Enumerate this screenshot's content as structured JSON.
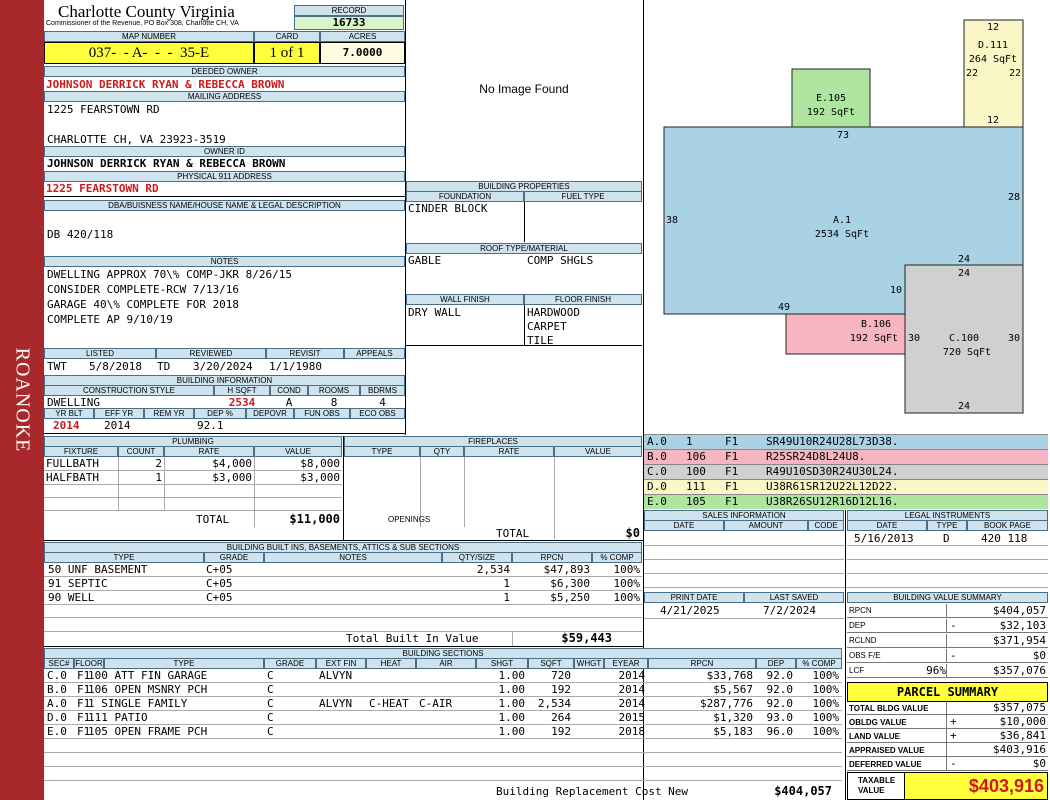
{
  "sidebar_label": "ROANOKE",
  "county": "Charlotte County Virginia",
  "commissioner": "Commissioner of the Revenue, PO Box 308, Charlotte CH, VA",
  "record": {
    "label": "RECORD",
    "value": "16733"
  },
  "map_number": {
    "label": "MAP NUMBER",
    "value": "037-  - A-  -  -  35-E"
  },
  "card": {
    "label": "CARD",
    "value": "1 of 1"
  },
  "acres": {
    "label": "ACRES",
    "value": "7.0000"
  },
  "deeded_owner": {
    "label": "DEEDED OWNER",
    "value": "JOHNSON DERRICK RYAN & REBECCA BROWN"
  },
  "mailing": {
    "label": "MAILING ADDRESS",
    "line1": "1225 FEARSTOWN RD",
    "line2": "CHARLOTTE CH, VA 23923-3519"
  },
  "owner_id": {
    "label": "OWNER ID",
    "value": "JOHNSON DERRICK RYAN & REBECCA BROWN"
  },
  "address911": {
    "label": "PHYSICAL 911 ADDRESS",
    "value": "1225 FEARSTOWN RD"
  },
  "dba": {
    "label": "DBA/BUISNESS NAME/HOUSE NAME & LEGAL DESCRIPTION",
    "value": "DB 420/118"
  },
  "notes": {
    "label": "NOTES",
    "lines": [
      "DWELLING APPROX 70\\% COMP-JKR 8/26/15",
      "CONSIDER COMPLETE-RCW 7/13/16",
      "GARAGE 40\\% COMPLETE FOR 2018",
      "COMPLETE AP 9/10/19"
    ]
  },
  "no_image": "No Image Found",
  "building_properties": {
    "label": "BUILDING PROPERTIES",
    "foundation_label": "FOUNDATION",
    "fuel_label": "FUEL TYPE",
    "foundation": "CINDER BLOCK",
    "roof_label": "ROOF TYPE/MATERIAL",
    "roof_type": "GABLE",
    "roof_material": "COMP SHGLS",
    "wall_label": "WALL FINISH",
    "floor_label": "FLOOR FINISH",
    "wall": "DRY WALL",
    "floor": [
      "HARDWOOD",
      "CARPET",
      "TILE"
    ]
  },
  "listed": {
    "label": "LISTED",
    "code": "TWT",
    "date": "5/8/2018"
  },
  "reviewed": {
    "label": "REVIEWED",
    "code": "TD",
    "date": "3/20/2024"
  },
  "revisit": {
    "label": "REVISIT",
    "date": "1/1/1980"
  },
  "appeals": {
    "label": "APPEALS"
  },
  "building_info": {
    "label": "BUILDING INFORMATION",
    "style_label": "CONSTRUCTION STYLE",
    "hsqft_label": "H SQFT",
    "cond_label": "COND",
    "rooms_label": "ROOMS",
    "bdrms_label": "BDRMS",
    "style": "DWELLING",
    "hsqft": "2534",
    "cond": "A",
    "rooms": "8",
    "bdrms": "4",
    "yrblt_label": "YR BLT",
    "effyr_label": "EFF YR",
    "remyr_label": "REM YR",
    "dep_label": "DEP %",
    "depovr_label": "DEPOVR",
    "funobs_label": "FUN OBS",
    "ecoobs_label": "ECO OBS",
    "yrblt": "2014",
    "effyr": "2014",
    "dep": "92.1"
  },
  "plumbing": {
    "label": "PLUMBING",
    "headers": [
      "FIXTURE",
      "COUNT",
      "RATE",
      "VALUE"
    ],
    "rows": [
      [
        "FULLBATH",
        "2",
        "$4,000",
        "$8,000"
      ],
      [
        "HALFBATH",
        "1",
        "$3,000",
        "$3,000"
      ]
    ],
    "total_label": "TOTAL",
    "total": "$11,000"
  },
  "fireplaces": {
    "label": "FIREPLACES",
    "headers": [
      "TYPE",
      "QTY",
      "RATE",
      "VALUE"
    ],
    "openings_label": "OPENINGS",
    "total_label": "TOTAL",
    "total": "$0"
  },
  "built_ins": {
    "label": "BUILDING BUILT INS, BASEMENTS, ATTICS & SUB SECTIONS",
    "headers": [
      "TYPE",
      "GRADE",
      "NOTES",
      "QTY/SIZE",
      "RPCN",
      "% COMP"
    ],
    "rows": [
      [
        "50 UNF BASEMENT",
        "C+05",
        "",
        "2,534",
        "$47,893",
        "100%"
      ],
      [
        "91 SEPTIC",
        "C+05",
        "",
        "1",
        "$6,300",
        "100%"
      ],
      [
        "90 WELL",
        "C+05",
        "",
        "1",
        "$5,250",
        "100%"
      ]
    ],
    "total_label": "Total Built In Value",
    "total": "$59,443"
  },
  "sketch": {
    "labels": [
      {
        "name": "A.1",
        "sqft": "2534 SqFt"
      },
      {
        "name": "B.106",
        "sqft": "192 SqFt"
      },
      {
        "name": "C.100",
        "sqft": "720 SqFt"
      },
      {
        "name": "D.111",
        "sqft": "264 SqFt"
      },
      {
        "name": "E.105",
        "sqft": "192 SqFt"
      }
    ],
    "dims": [
      "12",
      "22",
      "22",
      "12",
      "73",
      "28",
      "38",
      "24",
      "24",
      "10",
      "49",
      "30",
      "30",
      "24"
    ]
  },
  "vectors": [
    [
      "A.0",
      "1",
      "F1",
      "SR49U10R24U28L73D38."
    ],
    [
      "B.0",
      "106",
      "F1",
      "R25SR24D8L24U8."
    ],
    [
      "C.0",
      "100",
      "F1",
      "R49U10SD30R24U30L24."
    ],
    [
      "D.0",
      "111",
      "F1",
      "U38R61SR12U22L12D22."
    ],
    [
      "E.0",
      "105",
      "F1",
      "U38R26SU12R16D12L16."
    ]
  ],
  "vector_colors": [
    "#a9d3e5",
    "#f6b5c0",
    "#d0d0d0",
    "#fbf6c5",
    "#aee6a0"
  ],
  "sales": {
    "label": "SALES INFORMATION",
    "headers": [
      "DATE",
      "AMOUNT",
      "CODE"
    ]
  },
  "legal": {
    "label": "LEGAL INSTRUMENTS",
    "headers": [
      "DATE",
      "TYPE",
      "BOOK PAGE"
    ],
    "rows": [
      [
        "5/16/2013",
        "D",
        "420 118"
      ]
    ]
  },
  "print_date": {
    "label": "PRINT DATE",
    "value": "4/21/2025"
  },
  "last_saved": {
    "label": "LAST SAVED",
    "value": "7/2/2024"
  },
  "bvs": {
    "label": "BUILDING VALUE SUMMARY",
    "rows": [
      [
        "RPCN",
        "",
        "$404,057"
      ],
      [
        "DEP",
        "-",
        "$32,103"
      ],
      [
        "RCLND",
        "",
        "$371,954"
      ],
      [
        "OBS F/E",
        "-",
        "$0"
      ],
      [
        "LCF",
        "96%",
        "$357,076"
      ]
    ]
  },
  "parcel": {
    "label": "PARCEL SUMMARY",
    "rows": [
      [
        "TOTAL BLDG VALUE",
        "",
        "$357,075"
      ],
      [
        "OBLDG VALUE",
        "+",
        "$10,000"
      ],
      [
        "LAND VALUE",
        "+",
        "$36,841"
      ],
      [
        "APPRAISED VALUE",
        "",
        "$403,916"
      ],
      [
        "DEFERRED VALUE",
        "-",
        "$0"
      ]
    ],
    "taxable_label1": "TAXABLE",
    "taxable_label2": "VALUE",
    "taxable": "$403,916"
  },
  "sections": {
    "label": "BUILDING SECTIONS",
    "headers": [
      "SEC#",
      "FLOOR",
      "TYPE",
      "GRADE",
      "EXT FIN",
      "HEAT",
      "AIR",
      "SHGT",
      "SQFT",
      "WHGT",
      "EYEAR",
      "RPCN",
      "DEP",
      "% COMP"
    ],
    "rows": [
      [
        "C.0",
        "F1",
        "100 ATT FIN GARAGE",
        "C",
        "ALVYN",
        "",
        "",
        "1.00",
        "720",
        "",
        "2014",
        "$33,768",
        "92.0",
        "100%"
      ],
      [
        "B.0",
        "F1",
        "106 OPEN MSNRY PCH",
        "C",
        "",
        "",
        "",
        "1.00",
        "192",
        "",
        "2014",
        "$5,567",
        "92.0",
        "100%"
      ],
      [
        "A.0",
        "F1",
        "1 SINGLE FAMILY",
        "C",
        "ALVYN",
        "C-HEAT",
        "C-AIR",
        "1.00",
        "2,534",
        "",
        "2014",
        "$287,776",
        "92.0",
        "100%"
      ],
      [
        "D.0",
        "F1",
        "111 PATIO",
        "C",
        "",
        "",
        "",
        "1.00",
        "264",
        "",
        "2015",
        "$1,320",
        "93.0",
        "100%"
      ],
      [
        "E.0",
        "F1",
        "105 OPEN FRAME PCH",
        "C",
        "",
        "",
        "",
        "1.00",
        "192",
        "",
        "2018",
        "$5,183",
        "96.0",
        "100%"
      ]
    ],
    "total_label": "Building Replacement Cost New",
    "total": "$404,057"
  }
}
